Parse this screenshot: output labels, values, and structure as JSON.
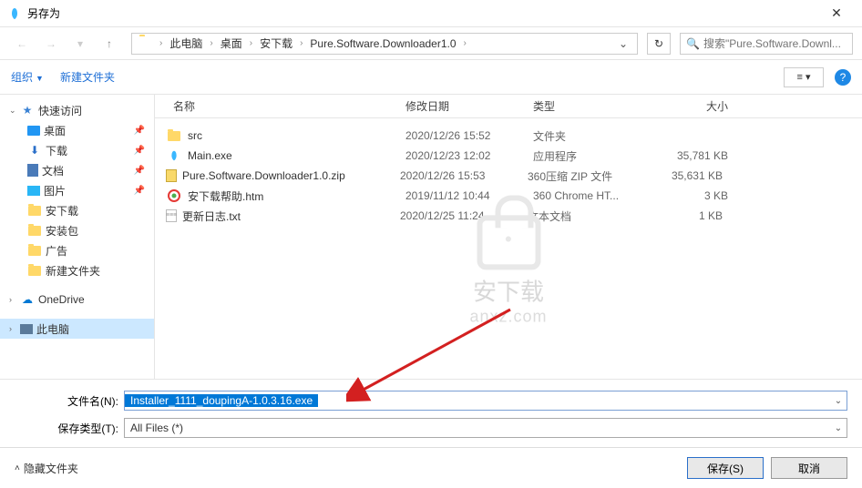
{
  "title": "另存为",
  "breadcrumb": {
    "items": [
      "此电脑",
      "桌面",
      "安下载",
      "Pure.Software.Downloader1.0"
    ],
    "search_placeholder": "搜索\"Pure.Software.Downl..."
  },
  "toolbar": {
    "organize": "组织",
    "new_folder": "新建文件夹"
  },
  "sidebar": {
    "quick_access": "快速访问",
    "items": [
      {
        "label": "桌面",
        "pinned": true,
        "icon": "desktop"
      },
      {
        "label": "下载",
        "pinned": true,
        "icon": "download"
      },
      {
        "label": "文档",
        "pinned": true,
        "icon": "document"
      },
      {
        "label": "图片",
        "pinned": true,
        "icon": "picture"
      },
      {
        "label": "安下载",
        "pinned": false,
        "icon": "folder"
      },
      {
        "label": "安装包",
        "pinned": false,
        "icon": "folder"
      },
      {
        "label": "广告",
        "pinned": false,
        "icon": "folder"
      },
      {
        "label": "新建文件夹",
        "pinned": false,
        "icon": "folder"
      }
    ],
    "onedrive": "OneDrive",
    "this_pc": "此电脑"
  },
  "columns": {
    "name": "名称",
    "date": "修改日期",
    "type": "类型",
    "size": "大小"
  },
  "files": [
    {
      "icon": "folder",
      "name": "src",
      "date": "2020/12/26 15:52",
      "type": "文件夹",
      "size": ""
    },
    {
      "icon": "exe",
      "name": "Main.exe",
      "date": "2020/12/23 12:02",
      "type": "应用程序",
      "size": "35,781 KB"
    },
    {
      "icon": "zip",
      "name": "Pure.Software.Downloader1.0.zip",
      "date": "2020/12/26 15:53",
      "type": "360压缩 ZIP 文件",
      "size": "35,631 KB"
    },
    {
      "icon": "htm",
      "name": "安下载帮助.htm",
      "date": "2019/11/12 10:44",
      "type": "360 Chrome HT...",
      "size": "3 KB"
    },
    {
      "icon": "txt",
      "name": "更新日志.txt",
      "date": "2020/12/25 11:24",
      "type": "文本文档",
      "size": "1 KB"
    }
  ],
  "watermark": {
    "cn": "安下载",
    "en": "anxz.com"
  },
  "form": {
    "filename_label": "文件名(N):",
    "filename_value": "Installer_1111_doupingA-1.0.3.16.exe",
    "filetype_label": "保存类型(T):",
    "filetype_value": "All Files (*)"
  },
  "footer": {
    "hide_folders": "隐藏文件夹",
    "save": "保存(S)",
    "cancel": "取消"
  }
}
